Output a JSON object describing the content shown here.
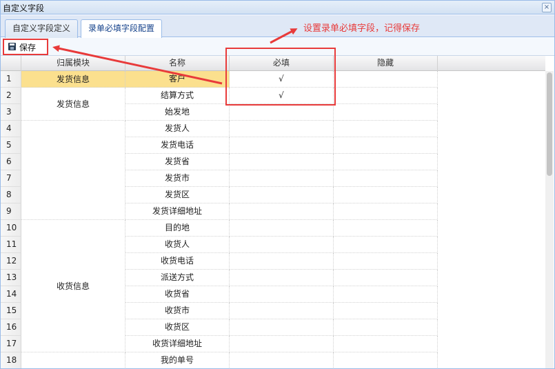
{
  "window": {
    "title": "自定义字段",
    "close_glyph": "×"
  },
  "tabs": [
    {
      "label": "自定义字段定义",
      "active": false
    },
    {
      "label": "录单必填字段配置",
      "active": true
    }
  ],
  "toolbar": {
    "save_label": "保存"
  },
  "annotation": {
    "text": "设置录单必填字段，记得保存",
    "color": "#e83a3a"
  },
  "grid": {
    "columns": [
      "归属模块",
      "名称",
      "必填",
      "隐藏"
    ],
    "row_numbers": [
      "1",
      "2",
      "3",
      "4",
      "5",
      "6",
      "7",
      "8",
      "9",
      "10",
      "11",
      "12",
      "13",
      "14",
      "15",
      "16",
      "17",
      "18"
    ],
    "groups": [
      {
        "label": "发货信息",
        "start": 1,
        "span": 1,
        "selected": true
      },
      {
        "label": "发货信息",
        "start": 2,
        "span": 2
      },
      {
        "label": "",
        "start": 4,
        "span": 6
      },
      {
        "label": "收货信息",
        "start": 10,
        "span": 8
      },
      {
        "label": "",
        "start": 18,
        "span": 1
      }
    ],
    "rows": [
      {
        "name": "客户",
        "required": "√",
        "hidden": ""
      },
      {
        "name": "结算方式",
        "required": "√",
        "hidden": ""
      },
      {
        "name": "始发地",
        "required": "",
        "hidden": ""
      },
      {
        "name": "发货人",
        "required": "",
        "hidden": ""
      },
      {
        "name": "发货电话",
        "required": "",
        "hidden": ""
      },
      {
        "name": "发货省",
        "required": "",
        "hidden": ""
      },
      {
        "name": "发货市",
        "required": "",
        "hidden": ""
      },
      {
        "name": "发货区",
        "required": "",
        "hidden": ""
      },
      {
        "name": "发货详细地址",
        "required": "",
        "hidden": ""
      },
      {
        "name": "目的地",
        "required": "",
        "hidden": ""
      },
      {
        "name": "收货人",
        "required": "",
        "hidden": ""
      },
      {
        "name": "收货电话",
        "required": "",
        "hidden": ""
      },
      {
        "name": "派送方式",
        "required": "",
        "hidden": ""
      },
      {
        "name": "收货省",
        "required": "",
        "hidden": ""
      },
      {
        "name": "收货市",
        "required": "",
        "hidden": ""
      },
      {
        "name": "收货区",
        "required": "",
        "hidden": ""
      },
      {
        "name": "收货详细地址",
        "required": "",
        "hidden": ""
      },
      {
        "name": "我的单号",
        "required": "",
        "hidden": ""
      }
    ],
    "selected_row": 1,
    "selected_color": "#fbe08e"
  }
}
